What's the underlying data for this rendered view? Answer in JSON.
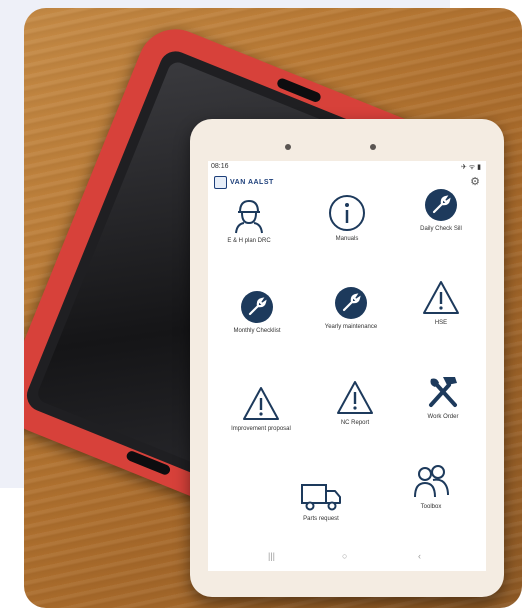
{
  "status_bar": {
    "time": "08:16",
    "icons": "✈ ᯤ ▮"
  },
  "header": {
    "brand": "VAN AALST"
  },
  "tiles": [
    {
      "label": "E & H plan DRC",
      "icon": "worker-head-icon"
    },
    {
      "label": "Manuals",
      "icon": "info-circle-icon"
    },
    {
      "label": "Daily Check Sill",
      "icon": "wrench-circle-icon"
    },
    {
      "label": "Monthly Checklist",
      "icon": "wrench-circle-icon"
    },
    {
      "label": "Yearly maintenance",
      "icon": "wrench-circle-icon"
    },
    {
      "label": "HSE",
      "icon": "warning-triangle-icon"
    },
    {
      "label": "Improvement proposal",
      "icon": "warning-triangle-icon"
    },
    {
      "label": "NC Report",
      "icon": "warning-triangle-icon"
    },
    {
      "label": "Work Order",
      "icon": "hammer-wrench-icon"
    },
    {
      "label": "Parts request",
      "icon": "truck-icon"
    },
    {
      "label": "Toolbox",
      "icon": "people-icon"
    }
  ],
  "nav_bar": {
    "recents": "|||",
    "home": "○",
    "back": "‹"
  },
  "colors": {
    "case": "#d7413a",
    "table": "#b87934",
    "icon_dark": "#1d3a5c"
  }
}
